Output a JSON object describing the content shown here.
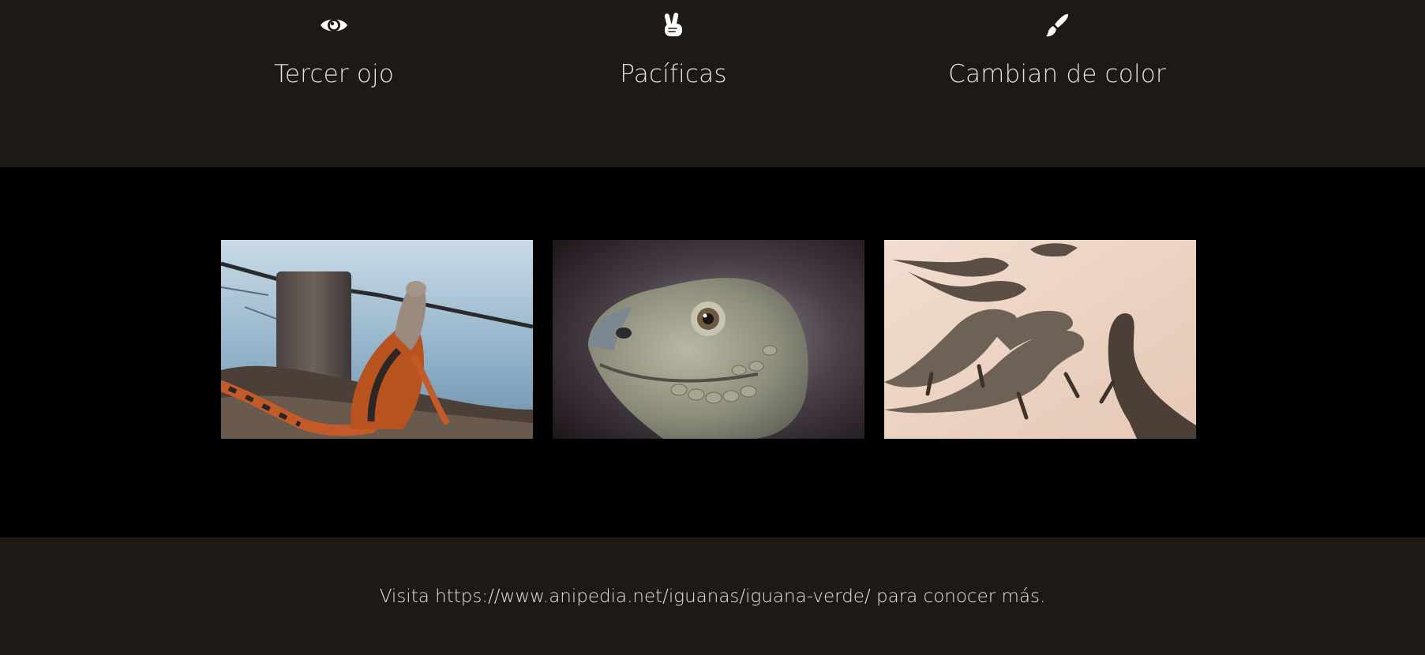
{
  "features": [
    {
      "icon": "eye-icon",
      "title": "Tercer ojo"
    },
    {
      "icon": "peace-hand-icon",
      "title": "Pacíficas"
    },
    {
      "icon": "paint-brush-icon",
      "title": "Cambian de color"
    }
  ],
  "gallery": {
    "photos": [
      {
        "subject": "iguana-on-shore-photo"
      },
      {
        "subject": "iguana-head-closeup-photo"
      },
      {
        "subject": "iguanas-on-sand-photo"
      }
    ]
  },
  "footer": {
    "note": "Visita https://www.anipedia.net/iguanas/iguana-verde/ para conocer más."
  },
  "colors": {
    "dark_brown_bg": "#1e1915",
    "black_bg": "#000000",
    "text": "#e4e0db"
  }
}
